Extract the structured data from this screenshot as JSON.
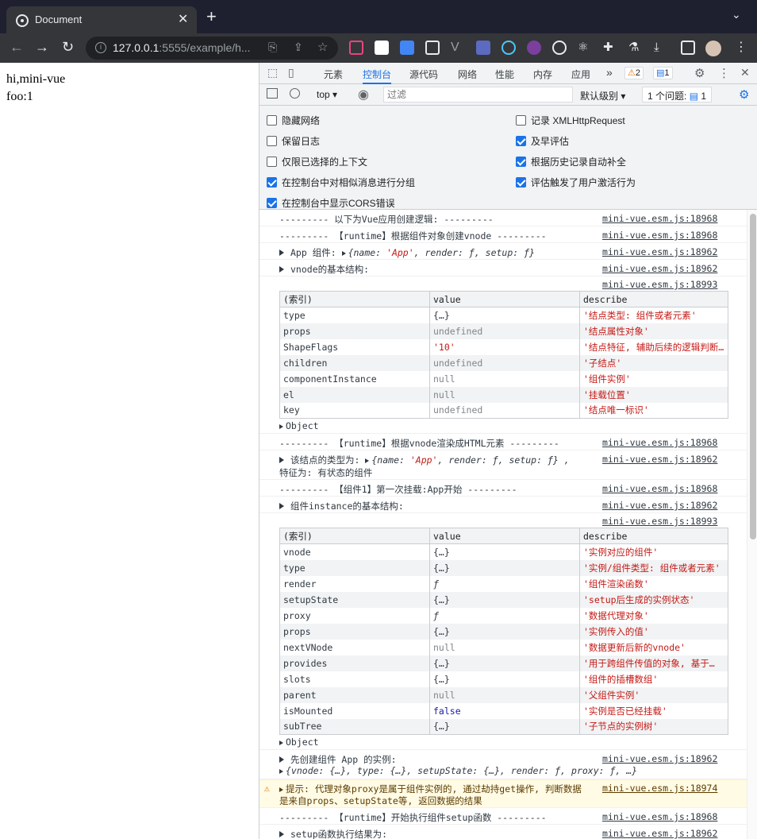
{
  "browser": {
    "tab_title": "Document",
    "close_symbol": "✕",
    "new_tab_symbol": "+",
    "url_host": "127.0.0.1",
    "url_rest": ":5555/example/h...",
    "back": "←",
    "forward": "→",
    "reload": "↻"
  },
  "page": {
    "line1": "hi,mini-vue",
    "line2": "foo:1"
  },
  "devtools": {
    "tabs": [
      "元素",
      "控制台",
      "源代码",
      "网络",
      "性能",
      "内存",
      "应用"
    ],
    "selected_tab": "控制台",
    "more": "»",
    "warn_count": "2",
    "msg_count": "1",
    "context": "top",
    "filter_placeholder": "过滤",
    "level": "默认级别",
    "issues_label": "1 个问题:",
    "issues_count": "1",
    "settings": {
      "left": [
        {
          "label": "隐藏网络",
          "checked": false
        },
        {
          "label": "保留日志",
          "checked": false
        },
        {
          "label": "仅限已选择的上下文",
          "checked": false
        },
        {
          "label": "在控制台中对相似消息进行分组",
          "checked": true
        },
        {
          "label": "在控制台中显示CORS错误",
          "checked": true
        }
      ],
      "right": [
        {
          "label": "记录 XMLHttpRequest",
          "checked": false
        },
        {
          "label": "及早评估",
          "checked": true
        },
        {
          "label": "根据历史记录自动补全",
          "checked": true
        },
        {
          "label": "评估触发了用户激活行为",
          "checked": true
        }
      ]
    }
  },
  "console": {
    "m1": "---------  以下为Vue应用创建逻辑:  ---------",
    "m1_src": "mini-vue.esm.js:18968",
    "m2": "---------  【runtime】根据组件对象创建vnode  ---------",
    "m2_src": "mini-vue.esm.js:18968",
    "m3_label": "App 组件:",
    "m3_obj_pre": "{name: ",
    "m3_obj_str": "'App'",
    "m3_obj_post": ", render: ƒ, setup: ƒ}",
    "m3_src": "mini-vue.esm.js:18962",
    "m4": "vnode的基本结构:",
    "m4_src": "mini-vue.esm.js:18962",
    "t1_src": "mini-vue.esm.js:18993",
    "table_headers": [
      "(索引)",
      "value",
      "describe"
    ],
    "table1": [
      {
        "key": "type",
        "value": "{…}",
        "vclass": "",
        "desc": "'结点类型: 组件或者元素'"
      },
      {
        "key": "props",
        "value": "undefined",
        "vclass": "gray",
        "desc": "'结点属性对象'"
      },
      {
        "key": "ShapeFlags",
        "value": "'10'",
        "vclass": "str",
        "desc": "'结点特征, 辅助后续的逻辑判断…"
      },
      {
        "key": "children",
        "value": "undefined",
        "vclass": "gray",
        "desc": "'子结点'"
      },
      {
        "key": "componentInstance",
        "value": "null",
        "vclass": "gray",
        "desc": "'组件实例'"
      },
      {
        "key": "el",
        "value": "null",
        "vclass": "gray",
        "desc": "'挂载位置'"
      },
      {
        "key": "key",
        "value": "undefined",
        "vclass": "gray",
        "desc": "'结点唯一标识'"
      }
    ],
    "object_label": "Object",
    "m5": "---------  【runtime】根据vnode渲染成HTML元素  ---------",
    "m5_src": "mini-vue.esm.js:18968",
    "m6_label": "该结点的类型为:",
    "m6_obj_pre": "{name: ",
    "m6_obj_str": "'App'",
    "m6_obj_post": ", render: ƒ, setup: ƒ} ,",
    "m6_line2": "特征为: 有状态的组件",
    "m6_src": "mini-vue.esm.js:18962",
    "m7": "---------  【组件1】第一次挂载:App开始  ---------",
    "m7_src": "mini-vue.esm.js:18968",
    "m8": "组件instance的基本结构:",
    "m8_src": "mini-vue.esm.js:18962",
    "t2_src": "mini-vue.esm.js:18993",
    "table2": [
      {
        "key": "vnode",
        "value": "{…}",
        "vclass": "",
        "desc": "'实例对应的组件'"
      },
      {
        "key": "type",
        "value": "{…}",
        "vclass": "",
        "desc": "'实例/组件类型: 组件或者元素'"
      },
      {
        "key": "render",
        "value": "ƒ",
        "vclass": "it",
        "desc": "'组件渲染函数'"
      },
      {
        "key": "setupState",
        "value": "{…}",
        "vclass": "",
        "desc": "'setup后生成的实例状态'"
      },
      {
        "key": "proxy",
        "value": "ƒ",
        "vclass": "it",
        "desc": "'数据代理对象'"
      },
      {
        "key": "props",
        "value": "{…}",
        "vclass": "",
        "desc": "'实例传入的值'"
      },
      {
        "key": "nextVNode",
        "value": "null",
        "vclass": "gray",
        "desc": "'数据更新后新的vnode'"
      },
      {
        "key": "provides",
        "value": "{…}",
        "vclass": "",
        "desc": "'用于跨组件传值的对象, 基于…"
      },
      {
        "key": "slots",
        "value": "{…}",
        "vclass": "",
        "desc": "'组件的插槽数组'"
      },
      {
        "key": "parent",
        "value": "null",
        "vclass": "gray",
        "desc": "'父组件实例'"
      },
      {
        "key": "isMounted",
        "value": "false",
        "vclass": "kw",
        "desc": "'实例是否已经挂载'"
      },
      {
        "key": "subTree",
        "value": "{…}",
        "vclass": "",
        "desc": "'子节点的实例树'"
      }
    ],
    "m9": "先创建组件 App 的实例:",
    "m9_line2": "{vnode: {…}, type: {…}, setupState: {…}, render: ƒ, proxy: ƒ, …}",
    "m9_src": "mini-vue.esm.js:18962",
    "w1_line1": "提示: 代理对象proxy是属于组件实例的, 通过劫持get操作, 判断数据",
    "w1_line2": "是来自props、setupState等, 返回数据的结果",
    "w1_src": "mini-vue.esm.js:18974",
    "m10": "---------  【runtime】开始执行组件setup函数  ---------",
    "m10_src": "mini-vue.esm.js:18968",
    "m11": "setup函数执行结果为:",
    "m11_src": "mini-vue.esm.js:18962"
  },
  "colors": {
    "accent": "#1a73e8",
    "string": "#c41a16",
    "keyword": "#1a1aa6",
    "warning_bg": "#fffbe5"
  }
}
